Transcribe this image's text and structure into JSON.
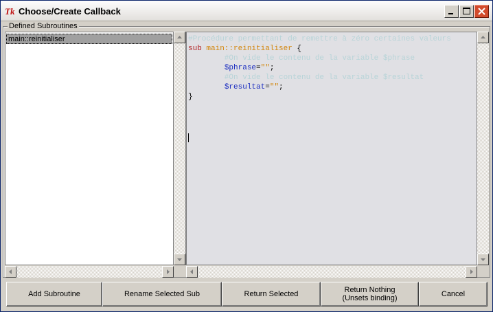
{
  "window": {
    "title": "Choose/Create Callback",
    "app_icon": "tk-icon",
    "controls": [
      "minimize-icon",
      "maximize-icon",
      "close-icon"
    ]
  },
  "groupbox": {
    "label": "Defined Subroutines"
  },
  "list": {
    "items": [
      "main::reinitialiser"
    ],
    "selected_index": 0
  },
  "code": {
    "lines": [
      [
        {
          "t": "#Procédure permettant de remettre à zéro certaines valeurs",
          "c": "comment"
        }
      ],
      [
        {
          "t": "sub ",
          "c": "keyword"
        },
        {
          "t": "main::reinitialiser",
          "c": "name"
        },
        {
          "t": " {",
          "c": "plain"
        }
      ],
      [
        {
          "t": "        #On vide le contenu de la variable $phrase",
          "c": "comment"
        }
      ],
      [
        {
          "t": "        ",
          "c": "plain"
        },
        {
          "t": "$phrase",
          "c": "var"
        },
        {
          "t": "=",
          "c": "plain"
        },
        {
          "t": "\"\"",
          "c": "str"
        },
        {
          "t": ";",
          "c": "plain"
        }
      ],
      [
        {
          "t": "        #On vide le contenu de la variable $resultat",
          "c": "comment"
        }
      ],
      [
        {
          "t": "        ",
          "c": "plain"
        },
        {
          "t": "$resultat",
          "c": "var"
        },
        {
          "t": "=",
          "c": "plain"
        },
        {
          "t": "\"\"",
          "c": "str"
        },
        {
          "t": ";",
          "c": "plain"
        }
      ],
      [
        {
          "t": "}",
          "c": "plain"
        }
      ]
    ]
  },
  "buttons": {
    "add": "Add Subroutine",
    "rename": "Rename Selected Sub",
    "return_selected": "Return Selected",
    "return_nothing_line1": "Return Nothing",
    "return_nothing_line2": "(Unsets binding)",
    "cancel": "Cancel"
  },
  "colors": {
    "titlebar": "#fdfdfd",
    "selection": "#a0a0a0",
    "editor_bg": "#e0e0e4",
    "comment": "#b8d4d8",
    "keyword": "#b22222",
    "identifier": "#d2850a",
    "variable": "#1b2dc0",
    "close_button": "#d24a2b"
  }
}
